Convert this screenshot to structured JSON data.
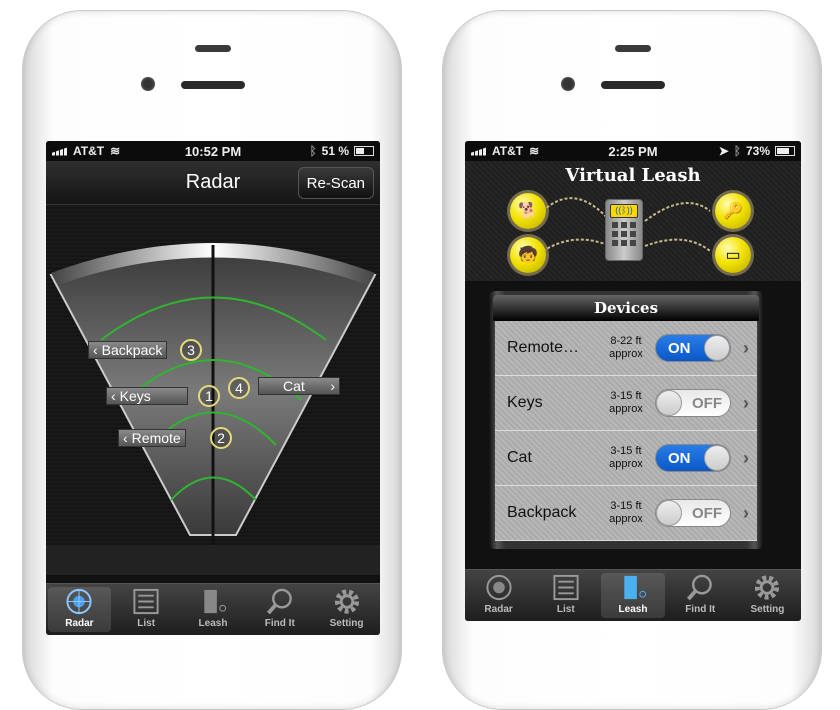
{
  "left_phone": {
    "status": {
      "carrier": "AT&T",
      "time": "10:52 PM",
      "battery": "51 %",
      "battery_level": 0.51
    },
    "nav": {
      "title": "Radar",
      "rescan": "Re-Scan"
    },
    "radar_items": [
      {
        "label": "Backpack",
        "num": "3",
        "side": "left"
      },
      {
        "label": "Keys",
        "num": "1",
        "side": "left"
      },
      {
        "label": "Cat",
        "num": "4",
        "side": "right"
      },
      {
        "label": "Remote",
        "num": "2",
        "side": "left"
      }
    ],
    "tabs": [
      {
        "label": "Radar",
        "active": true
      },
      {
        "label": "List"
      },
      {
        "label": "Leash"
      },
      {
        "label": "Find It"
      },
      {
        "label": "Setting"
      }
    ]
  },
  "right_phone": {
    "status": {
      "carrier": "AT&T",
      "time": "2:25 PM",
      "battery": "73%",
      "battery_level": 0.73
    },
    "header": {
      "title": "Virtual Leash"
    },
    "devices": {
      "title": "Devices",
      "rows": [
        {
          "name": "Remote…",
          "range1": "8-22 ft",
          "range2": "approx",
          "state": "ON"
        },
        {
          "name": "Keys",
          "range1": "3-15 ft",
          "range2": "approx",
          "state": "OFF"
        },
        {
          "name": "Cat",
          "range1": "3-15 ft",
          "range2": "approx",
          "state": "ON"
        },
        {
          "name": "Backpack",
          "range1": "3-15 ft",
          "range2": "approx",
          "state": "OFF"
        }
      ]
    },
    "tabs": [
      {
        "label": "Radar"
      },
      {
        "label": "List"
      },
      {
        "label": "Leash",
        "active": true
      },
      {
        "label": "Find It"
      },
      {
        "label": "Setting"
      }
    ]
  },
  "colors": {
    "radar_ring": "#2fb52f",
    "toggle_on": "#1366d6",
    "ball": "#f3e300"
  }
}
